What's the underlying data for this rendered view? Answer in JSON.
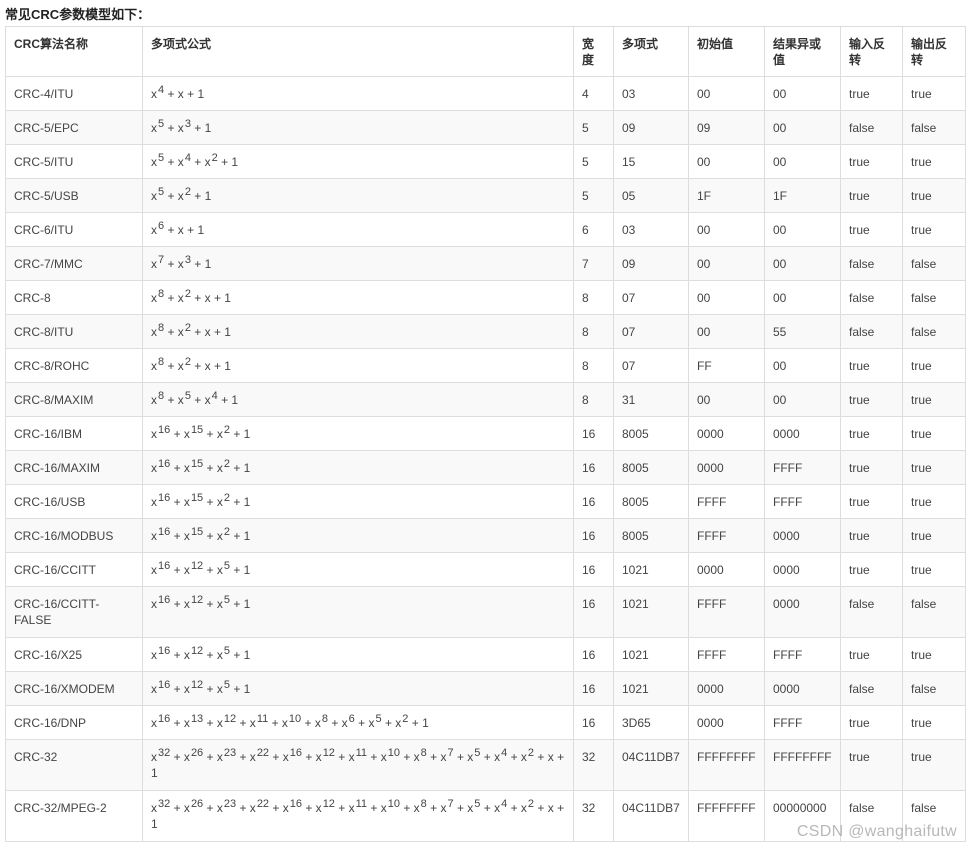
{
  "heading": "常见CRC参数模型如下：",
  "columns": [
    "CRC算法名称",
    "多项式公式",
    "宽度",
    "多项式",
    "初始值",
    "结果异或值",
    "输入反转",
    "输出反转"
  ],
  "rows": [
    {
      "name": "CRC-4/ITU",
      "formula": [
        [
          "x",
          "4"
        ],
        [
          "+ x",
          ""
        ],
        [
          "+ 1",
          ""
        ]
      ],
      "width": "4",
      "poly": "03",
      "init": "00",
      "xorout": "00",
      "refin": "true",
      "refout": "true"
    },
    {
      "name": "CRC-5/EPC",
      "formula": [
        [
          "x",
          "5"
        ],
        [
          "+ x",
          "3"
        ],
        [
          "+ 1",
          ""
        ]
      ],
      "width": "5",
      "poly": "09",
      "init": "09",
      "xorout": "00",
      "refin": "false",
      "refout": "false"
    },
    {
      "name": "CRC-5/ITU",
      "formula": [
        [
          "x",
          "5"
        ],
        [
          "+ x",
          "4"
        ],
        [
          "+ x",
          "2"
        ],
        [
          "+ 1",
          ""
        ]
      ],
      "width": "5",
      "poly": "15",
      "init": "00",
      "xorout": "00",
      "refin": "true",
      "refout": "true"
    },
    {
      "name": "CRC-5/USB",
      "formula": [
        [
          "x",
          "5"
        ],
        [
          "+ x",
          "2"
        ],
        [
          "+ 1",
          ""
        ]
      ],
      "width": "5",
      "poly": "05",
      "init": "1F",
      "xorout": "1F",
      "refin": "true",
      "refout": "true"
    },
    {
      "name": "CRC-6/ITU",
      "formula": [
        [
          "x",
          "6"
        ],
        [
          "+ x",
          ""
        ],
        [
          "+ 1",
          ""
        ]
      ],
      "width": "6",
      "poly": "03",
      "init": "00",
      "xorout": "00",
      "refin": "true",
      "refout": "true"
    },
    {
      "name": "CRC-7/MMC",
      "formula": [
        [
          "x",
          "7"
        ],
        [
          "+ x",
          "3"
        ],
        [
          "+ 1",
          ""
        ]
      ],
      "width": "7",
      "poly": "09",
      "init": "00",
      "xorout": "00",
      "refin": "false",
      "refout": "false"
    },
    {
      "name": "CRC-8",
      "formula": [
        [
          "x",
          "8"
        ],
        [
          "+ x",
          "2"
        ],
        [
          "+ x",
          ""
        ],
        [
          "+ 1",
          ""
        ]
      ],
      "width": "8",
      "poly": "07",
      "init": "00",
      "xorout": "00",
      "refin": "false",
      "refout": "false"
    },
    {
      "name": "CRC-8/ITU",
      "formula": [
        [
          "x",
          "8"
        ],
        [
          "+ x",
          "2"
        ],
        [
          "+ x",
          ""
        ],
        [
          "+ 1",
          ""
        ]
      ],
      "width": "8",
      "poly": "07",
      "init": "00",
      "xorout": "55",
      "refin": "false",
      "refout": "false"
    },
    {
      "name": "CRC-8/ROHC",
      "formula": [
        [
          "x",
          "8"
        ],
        [
          "+ x",
          "2"
        ],
        [
          "+ x",
          ""
        ],
        [
          "+ 1",
          ""
        ]
      ],
      "width": "8",
      "poly": "07",
      "init": "FF",
      "xorout": "00",
      "refin": "true",
      "refout": "true"
    },
    {
      "name": "CRC-8/MAXIM",
      "formula": [
        [
          "x",
          "8"
        ],
        [
          "+ x",
          "5"
        ],
        [
          "+ x",
          "4"
        ],
        [
          "+ 1",
          ""
        ]
      ],
      "width": "8",
      "poly": "31",
      "init": "00",
      "xorout": "00",
      "refin": "true",
      "refout": "true"
    },
    {
      "name": "CRC-16/IBM",
      "formula": [
        [
          "x",
          "16"
        ],
        [
          "+ x",
          "15"
        ],
        [
          "+ x",
          "2"
        ],
        [
          "+ 1",
          ""
        ]
      ],
      "width": "16",
      "poly": "8005",
      "init": "0000",
      "xorout": "0000",
      "refin": "true",
      "refout": "true"
    },
    {
      "name": "CRC-16/MAXIM",
      "formula": [
        [
          "x",
          "16"
        ],
        [
          "+ x",
          "15"
        ],
        [
          "+ x",
          "2"
        ],
        [
          "+ 1",
          ""
        ]
      ],
      "width": "16",
      "poly": "8005",
      "init": "0000",
      "xorout": "FFFF",
      "refin": "true",
      "refout": "true"
    },
    {
      "name": "CRC-16/USB",
      "formula": [
        [
          "x",
          "16"
        ],
        [
          "+ x",
          "15"
        ],
        [
          "+ x",
          "2"
        ],
        [
          "+ 1",
          ""
        ]
      ],
      "width": "16",
      "poly": "8005",
      "init": "FFFF",
      "xorout": "FFFF",
      "refin": "true",
      "refout": "true"
    },
    {
      "name": "CRC-16/MODBUS",
      "formula": [
        [
          "x",
          "16"
        ],
        [
          "+ x",
          "15"
        ],
        [
          "+ x",
          "2"
        ],
        [
          "+ 1",
          ""
        ]
      ],
      "width": "16",
      "poly": "8005",
      "init": "FFFF",
      "xorout": "0000",
      "refin": "true",
      "refout": "true"
    },
    {
      "name": "CRC-16/CCITT",
      "formula": [
        [
          "x",
          "16"
        ],
        [
          "+ x",
          "12"
        ],
        [
          "+ x",
          "5"
        ],
        [
          "+ 1",
          ""
        ]
      ],
      "width": "16",
      "poly": "1021",
      "init": "0000",
      "xorout": "0000",
      "refin": "true",
      "refout": "true"
    },
    {
      "name": "CRC-16/CCITT-FALSE",
      "formula": [
        [
          "x",
          "16"
        ],
        [
          "+ x",
          "12"
        ],
        [
          "+ x",
          "5"
        ],
        [
          "+ 1",
          ""
        ]
      ],
      "width": "16",
      "poly": "1021",
      "init": "FFFF",
      "xorout": "0000",
      "refin": "false",
      "refout": "false"
    },
    {
      "name": "CRC-16/X25",
      "formula": [
        [
          "x",
          "16"
        ],
        [
          "+ x",
          "12"
        ],
        [
          "+ x",
          "5"
        ],
        [
          "+ 1",
          ""
        ]
      ],
      "width": "16",
      "poly": "1021",
      "init": "FFFF",
      "xorout": "FFFF",
      "refin": "true",
      "refout": "true"
    },
    {
      "name": "CRC-16/XMODEM",
      "formula": [
        [
          "x",
          "16"
        ],
        [
          "+ x",
          "12"
        ],
        [
          "+ x",
          "5"
        ],
        [
          "+ 1",
          ""
        ]
      ],
      "width": "16",
      "poly": "1021",
      "init": "0000",
      "xorout": "0000",
      "refin": "false",
      "refout": "false"
    },
    {
      "name": "CRC-16/DNP",
      "formula": [
        [
          "x",
          "16"
        ],
        [
          "+ x",
          "13"
        ],
        [
          "+ x",
          "12"
        ],
        [
          "+ x",
          "11"
        ],
        [
          "+ x",
          "10"
        ],
        [
          "+ x",
          "8"
        ],
        [
          "+ x",
          "6"
        ],
        [
          "+ x",
          "5"
        ],
        [
          "+ x",
          "2"
        ],
        [
          "+ 1",
          ""
        ]
      ],
      "width": "16",
      "poly": "3D65",
      "init": "0000",
      "xorout": "FFFF",
      "refin": "true",
      "refout": "true"
    },
    {
      "name": "CRC-32",
      "formula": [
        [
          "x",
          "32"
        ],
        [
          "+ x",
          "26"
        ],
        [
          "+ x",
          "23"
        ],
        [
          "+ x",
          "22"
        ],
        [
          "+ x",
          "16"
        ],
        [
          "+ x",
          "12"
        ],
        [
          "+ x",
          "11"
        ],
        [
          "+ x",
          "10"
        ],
        [
          "+ x",
          "8"
        ],
        [
          "+ x",
          "7"
        ],
        [
          "+ x",
          "5"
        ],
        [
          "+ x",
          "4"
        ],
        [
          "+ x",
          "2"
        ],
        [
          "+ x",
          ""
        ],
        [
          "+ 1",
          ""
        ]
      ],
      "width": "32",
      "poly": "04C11DB7",
      "init": "FFFFFFFF",
      "xorout": "FFFFFFFF",
      "refin": "true",
      "refout": "true"
    },
    {
      "name": "CRC-32/MPEG-2",
      "formula": [
        [
          "x",
          "32"
        ],
        [
          "+ x",
          "26"
        ],
        [
          "+ x",
          "23"
        ],
        [
          "+ x",
          "22"
        ],
        [
          "+ x",
          "16"
        ],
        [
          "+ x",
          "12"
        ],
        [
          "+ x",
          "11"
        ],
        [
          "+ x",
          "10"
        ],
        [
          "+ x",
          "8"
        ],
        [
          "+ x",
          "7"
        ],
        [
          "+ x",
          "5"
        ],
        [
          "+ x",
          "4"
        ],
        [
          "+ x",
          "2"
        ],
        [
          "+ x",
          ""
        ],
        [
          "+ 1",
          ""
        ]
      ],
      "width": "32",
      "poly": "04C11DB7",
      "init": "FFFFFFFF",
      "xorout": "00000000",
      "refin": "false",
      "refout": "false"
    }
  ],
  "watermark": "CSDN @wanghaifutw"
}
